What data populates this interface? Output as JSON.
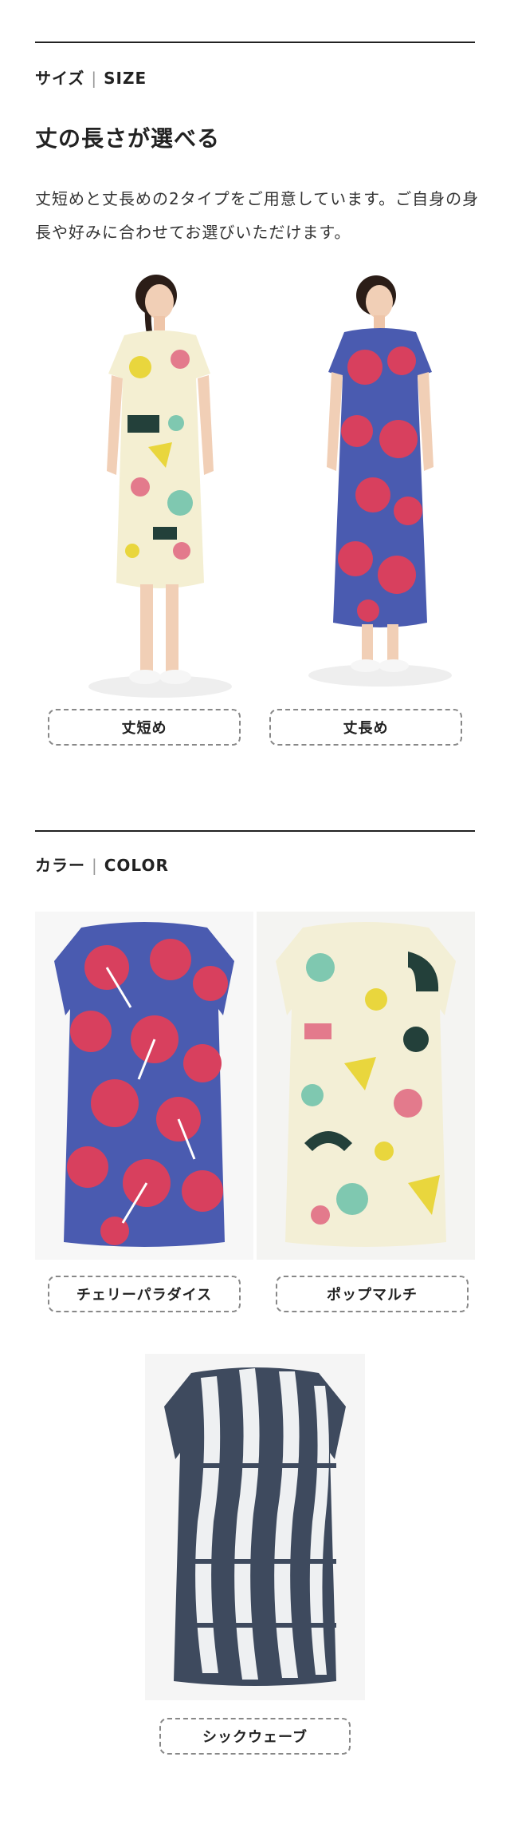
{
  "size_section": {
    "label_jp": "サイズ",
    "label_en": "SIZE",
    "heading": "丈の長さが選べる",
    "description": "丈短めと丈長めの2タイプをご用意しています。ご自身の身長や好みに合わせてお選びいただけます。",
    "options": [
      {
        "label": "丈短め",
        "photo": "model-short-dress-photo"
      },
      {
        "label": "丈長め",
        "photo": "model-long-dress-photo"
      }
    ]
  },
  "color_section": {
    "label_jp": "カラー",
    "label_en": "COLOR",
    "options": [
      {
        "label": "チェリーパラダイス",
        "swatch": "#d8405e"
      },
      {
        "label": "ポップマルチ",
        "swatch": "#f3efd6"
      },
      {
        "label": "シックウェーブ",
        "swatch": "#3e4a5e"
      }
    ]
  },
  "colors": {
    "rule": "#222222",
    "pill_border": "#888888",
    "cherry_pink": "#d8405e",
    "cherry_blue": "#4a5bb0",
    "pop_cream": "#f3efd6",
    "wave_navy": "#3e4a5e"
  }
}
